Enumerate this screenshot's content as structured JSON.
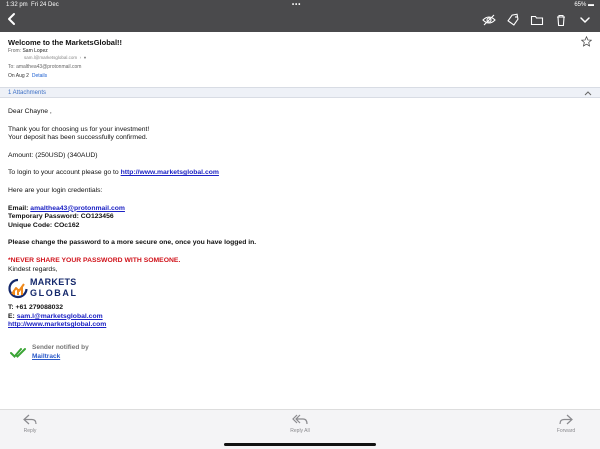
{
  "status_bar": {
    "time": "1:32 pm",
    "date": "Fri 24 Dec",
    "dots": "•••",
    "battery": "65%"
  },
  "header": {
    "subject": "Welcome to the MarketsGlobal!!",
    "from_label": "From:",
    "from_name": "Sam Lopez",
    "from_address": "sam.l@marketsglobal.com",
    "to_label": "To:",
    "to_address": "amalthea43@protonmail.com",
    "date": "On Aug 2",
    "details_link": "Details"
  },
  "attachments": {
    "label": "1 Attachments"
  },
  "body": {
    "greeting": "Dear  Chayne  ,",
    "line1": "Thank you for choosing us for your investment!",
    "line2": "Your deposit has been successfully confirmed.",
    "amount": "Amount: (250USD) (340AUD)",
    "login_prefix": "To login to your account please go to ",
    "login_link": "http://www.marketsglobal.com",
    "cred_intro": "Here are your login credentials:",
    "email_label": "Email: ",
    "email_value": "amalthea43@protonmail.com",
    "temp_pw": "Temporary Password: CO123456",
    "unique_code": "Unique Code: COc162",
    "change_pw": "Please change the password to a more secure one, once you have logged in.",
    "warning": "*NEVER SHARE YOUR PASSWORD WITH SOMEONE.",
    "regards": "Kindest regards,",
    "logo_line1": "MARKETS",
    "logo_line2": "GLOBAL",
    "phone": "T: +61 279088032",
    "email_sig_label": "E: ",
    "email_sig": "sam.l@marketsglobal.com",
    "site": "http://www.marketsglobal.com"
  },
  "mailtrack": {
    "line1": "Sender notified by",
    "line2": "Mailtrack"
  },
  "bottom_bar": {
    "reply": "Reply",
    "reply_all": "Reply All",
    "forward": "Forward"
  },
  "icons": {
    "back": "chevron-left-icon",
    "toolbar": [
      "eye-slash-icon",
      "tag-icon",
      "folder-icon",
      "trash-icon",
      "chevron-down-icon"
    ],
    "star": "star-icon"
  },
  "colors": {
    "toolbar": "#4a4a4c",
    "link": "#1c22c4",
    "warning": "#d0131b",
    "logo": "#14286b",
    "accent_orange": "#f08a1c"
  }
}
